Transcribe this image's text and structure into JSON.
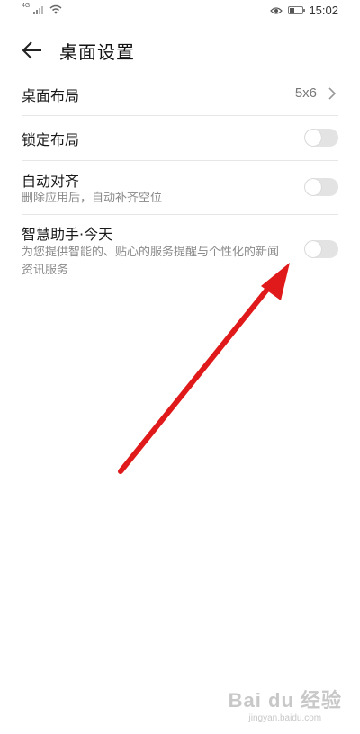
{
  "status_bar": {
    "network": "4G",
    "time": "15:02",
    "icons": [
      "signal-icon",
      "wifi-icon",
      "eye-icon",
      "battery-icon"
    ],
    "battery_level": 0.4
  },
  "header": {
    "back_icon": "arrow-left-icon",
    "title": "桌面设置"
  },
  "settings": {
    "layout": {
      "label": "桌面布局",
      "value": "5x6"
    },
    "lock_layout": {
      "label": "锁定布局",
      "enabled": false
    },
    "auto_align": {
      "label": "自动对齐",
      "description": "删除应用后，自动补齐空位",
      "enabled": false
    },
    "smart_assistant": {
      "label": "智慧助手·今天",
      "description": "为您提供智能的、贴心的服务提醒与个性化的新闻资讯服务",
      "enabled": false
    }
  },
  "annotation": {
    "arrow_color": "#e01a1a"
  },
  "watermark": {
    "logo": "Bai du 经验",
    "url": "jingyan.baidu.com"
  },
  "colors": {
    "toggle_off": "#e3e3e3",
    "divider": "#e6e6e6",
    "subtext": "#8a8a8a"
  }
}
